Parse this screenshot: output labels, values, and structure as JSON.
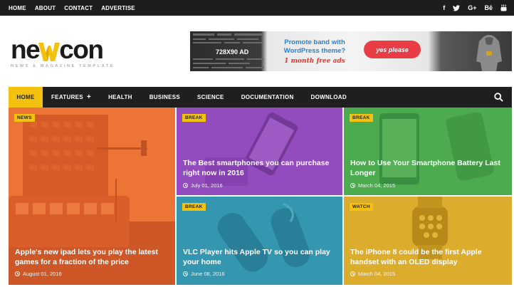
{
  "topbar": {
    "links": [
      "HOME",
      "ABOUT",
      "CONTACT",
      "ADVERTISE"
    ],
    "social": [
      {
        "icon": "facebook-icon",
        "glyph": "f"
      },
      {
        "icon": "twitter-icon",
        "glyph": "t"
      },
      {
        "icon": "google-plus-icon",
        "glyph": "G+"
      },
      {
        "icon": "behance-icon",
        "glyph": "Bē"
      },
      {
        "icon": "youtube-icon",
        "glyph": "▶"
      }
    ]
  },
  "logo": {
    "pre": "ne",
    "post": "con",
    "tagline": "NEWS & MAGAZINE TEMPLATE",
    "accent": "#f4c10e"
  },
  "ad": {
    "size": "728X90 AD",
    "promote": "Promote band with WordPress theme?",
    "free": "1 month free ads",
    "button": "yes please"
  },
  "nav": {
    "items": [
      "HOME",
      "FEATURES",
      "HEALTH",
      "BUSINESS",
      "SCIENCE",
      "DOCUMENTATION",
      "DOWNLOAD"
    ],
    "features_plus": "+",
    "active_color": "#f4c10e"
  },
  "cards": [
    {
      "badge": "NEWS",
      "title": "Apple's new ipad lets you play the latest games for a fraction of the price",
      "date": "August 01, 2016",
      "tint": "#e8622a"
    },
    {
      "badge": "BREAK",
      "title": "The Best smartphones you can purchase right now in 2016",
      "date": "July 01, 2016",
      "tint": "#8b3fb5"
    },
    {
      "badge": "BREAK",
      "title": "How to Use Your Smartphone Battery Last Longer",
      "date": "March 04, 2015",
      "tint": "#3ea04a"
    },
    {
      "badge": "BREAK",
      "title": "VLC Player hits Apple TV so you can play your home",
      "date": "June 08, 2016",
      "tint": "#2c8fa8"
    },
    {
      "badge": "WATCH",
      "title": "The iPhone 8 could be the first Apple handset with an OLED display",
      "date": "March 04, 2015",
      "tint": "#d6a21e"
    }
  ]
}
